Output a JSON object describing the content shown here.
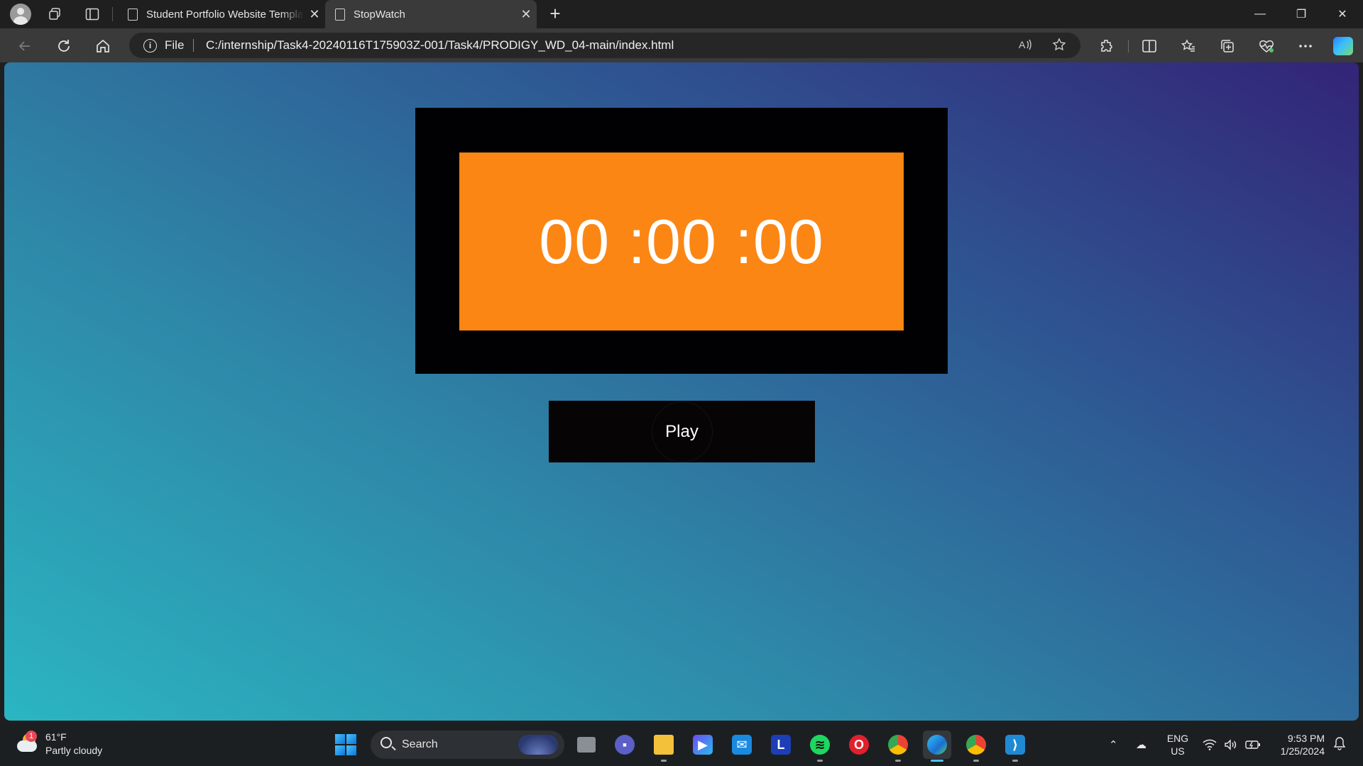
{
  "browser": {
    "tabs": [
      {
        "title": "Student Portfolio Website Template",
        "active": false,
        "close_glyph": "✕"
      },
      {
        "title": "StopWatch",
        "active": true,
        "close_glyph": "✕"
      }
    ],
    "new_tab_glyph": "+",
    "window_controls": {
      "minimize": "—",
      "restore": "❐",
      "close": "✕"
    },
    "address": {
      "scheme_label": "File",
      "url": "C:/internship/Task4-20240116T175903Z-001/Task4/PRODIGY_WD_04-main/index.html"
    },
    "icons": {
      "profile": "profile-avatar-icon",
      "workspaces": "workspaces-icon",
      "tab_actions": "tab-actions-icon",
      "back": "back-arrow-icon",
      "refresh": "refresh-icon",
      "home": "home-icon",
      "read_aloud": "read-aloud-icon",
      "favorite": "star-icon",
      "extensions": "extensions-icon",
      "split_screen": "split-screen-icon",
      "favorites": "favorites-icon",
      "collections": "collections-icon",
      "performance": "browser-essentials-icon",
      "more": "more-icon",
      "copilot": "copilot-icon"
    }
  },
  "page": {
    "stopwatch": {
      "time": "00 :00 :00",
      "play_label": "Play"
    },
    "colors": {
      "display": "#fb8614",
      "frame": "#010103",
      "gradient_start": "#2bb5c2",
      "gradient_end": "#332478"
    }
  },
  "taskbar": {
    "weather": {
      "temp": "61°F",
      "condition": "Partly cloudy",
      "badge": "1"
    },
    "search_label": "Search",
    "apps": [
      "task-view-icon",
      "teams-chat-icon",
      "file-explorer-icon",
      "copilot-app-icon",
      "mail-icon",
      "l-app-icon",
      "spotify-icon",
      "opera-icon",
      "chrome-icon",
      "edge-icon",
      "chrome-profile-icon",
      "vscode-icon"
    ],
    "language": {
      "line1": "ENG",
      "line2": "US"
    },
    "clock": {
      "time": "9:53 PM",
      "date": "1/25/2024"
    }
  }
}
